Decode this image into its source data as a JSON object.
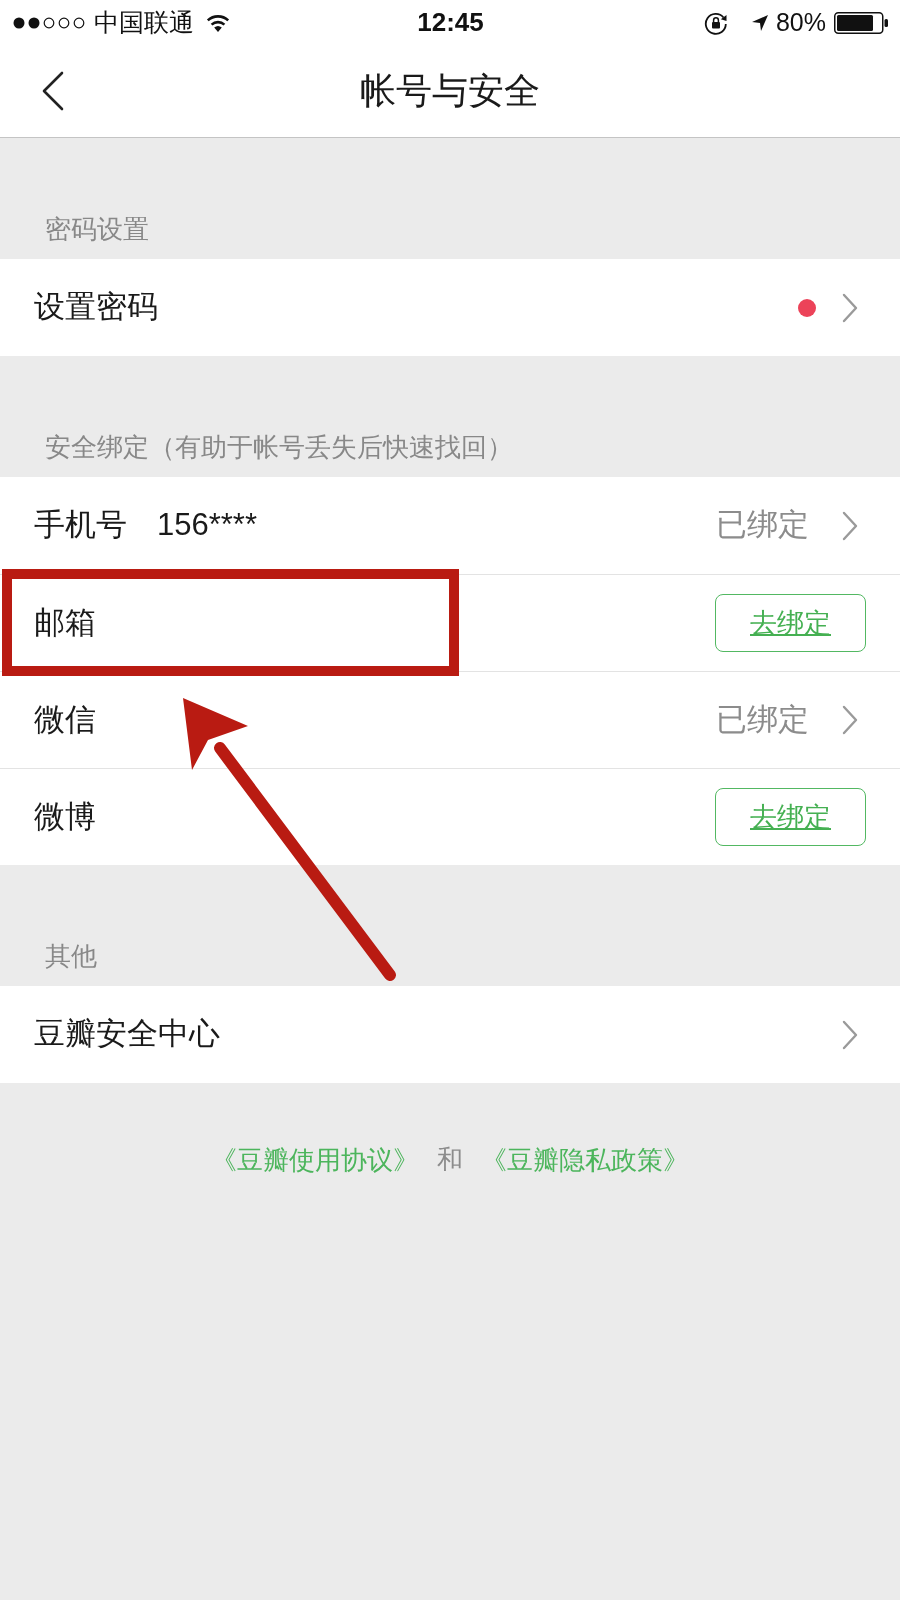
{
  "status_bar": {
    "carrier": "中国联通",
    "time": "12:45",
    "battery": "80%"
  },
  "nav": {
    "title": "帐号与安全"
  },
  "sections": [
    {
      "header": "密码设置",
      "rows": [
        {
          "kind": "nav",
          "label": "设置密码",
          "dot": true,
          "highlighted": false
        }
      ]
    },
    {
      "header": "安全绑定（有助于帐号丢失后快速找回）",
      "rows": [
        {
          "kind": "status",
          "label": "手机号",
          "value": "156****",
          "status": "已绑定",
          "dot": false,
          "highlighted": false
        },
        {
          "kind": "action",
          "label": "邮箱",
          "button": "去绑定",
          "dot": false,
          "highlighted": true
        },
        {
          "kind": "status",
          "label": "微信",
          "status": "已绑定",
          "dot": false,
          "highlighted": false
        },
        {
          "kind": "action",
          "label": "微博",
          "button": "去绑定",
          "dot": false,
          "highlighted": false
        }
      ]
    },
    {
      "header": "其他",
      "rows": [
        {
          "kind": "nav",
          "label": "豆瓣安全中心",
          "dot": false,
          "highlighted": false
        }
      ]
    }
  ],
  "footer": {
    "links": [
      {
        "label": "《豆瓣使用协议》"
      },
      {
        "label": "《豆瓣隐私政策》"
      }
    ],
    "separator": "和"
  }
}
